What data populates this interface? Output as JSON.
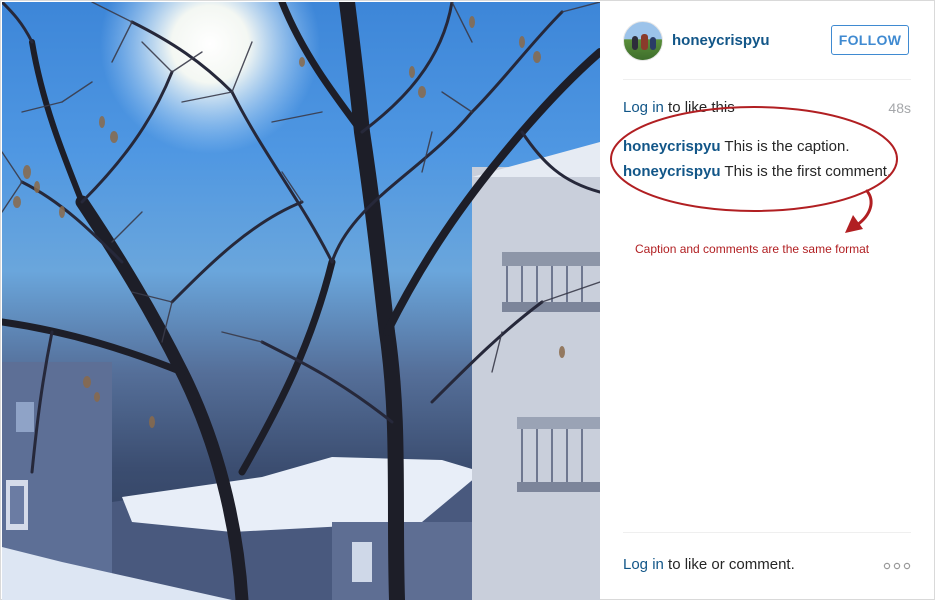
{
  "post": {
    "author": {
      "username": "honeycrispyu",
      "follow_label": "FOLLOW"
    },
    "like_prompt": {
      "link_text": "Log in",
      "rest_text": " to like this"
    },
    "timestamp": "48s",
    "comments": [
      {
        "author": "honeycrispyu",
        "text": " This is the caption."
      },
      {
        "author": "honeycrispyu",
        "text": " This is the first comment."
      }
    ],
    "footer": {
      "link_text": "Log in",
      "rest_text": " to like or comment.",
      "more_icon": "ellipsis-icon"
    }
  },
  "annotation": {
    "note": "Caption and comments are the same format",
    "color": "#b11f22"
  },
  "colors": {
    "link": "#125688",
    "follow_button": "#3f8ad1",
    "muted": "#a5a7aa"
  }
}
